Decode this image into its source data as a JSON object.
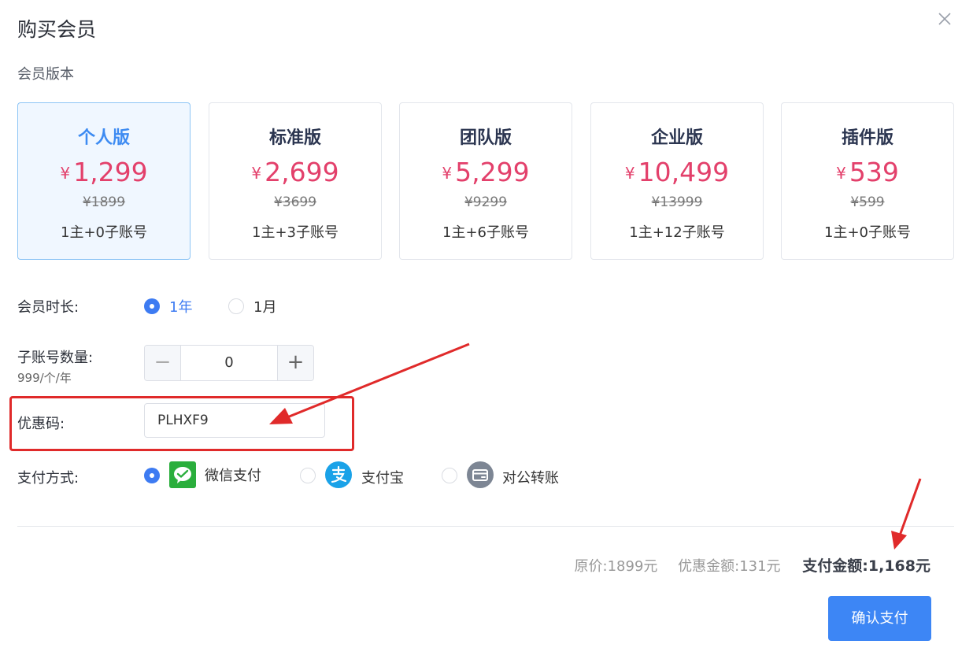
{
  "dialog": {
    "title": "购买会员",
    "section_label": "会员版本"
  },
  "plans": [
    {
      "name": "个人版",
      "currency": "¥",
      "price": "1,299",
      "original": "¥1899",
      "accounts": "1主+0子账号",
      "active": true
    },
    {
      "name": "标准版",
      "currency": "¥",
      "price": "2,699",
      "original": "¥3699",
      "accounts": "1主+3子账号",
      "active": false
    },
    {
      "name": "团队版",
      "currency": "¥",
      "price": "5,299",
      "original": "¥9299",
      "accounts": "1主+6子账号",
      "active": false
    },
    {
      "name": "企业版",
      "currency": "¥",
      "price": "10,499",
      "original": "¥13999",
      "accounts": "1主+12子账号",
      "active": false
    },
    {
      "name": "插件版",
      "currency": "¥",
      "price": "539",
      "original": "¥599",
      "accounts": "1主+0子账号",
      "active": false
    }
  ],
  "duration": {
    "label": "会员时长:",
    "options": [
      "1年",
      "1月"
    ],
    "selected": "1年"
  },
  "subaccounts": {
    "label": "子账号数量:",
    "unit_price": "999/个/年",
    "value": "0",
    "minus": "−",
    "plus": "+"
  },
  "coupon": {
    "label": "优惠码:",
    "value": "PLHXF9"
  },
  "payment": {
    "label": "支付方式:",
    "options": [
      {
        "label": "微信支付",
        "icon": "wechat-pay-icon",
        "selected": true
      },
      {
        "label": "支付宝",
        "icon": "alipay-icon",
        "selected": false
      },
      {
        "label": "对公转账",
        "icon": "bank-transfer-icon",
        "selected": false
      }
    ]
  },
  "summary": {
    "original": "原价:1899元",
    "discount": "优惠金额:131元",
    "total": "支付金额:1,168元"
  },
  "confirm_label": "确认支付",
  "colors": {
    "accent": "#3d86f5",
    "price": "#e3406b",
    "annotation": "#e02a2a",
    "wechat": "#2aae3c",
    "alipay": "#1aa2e8"
  }
}
